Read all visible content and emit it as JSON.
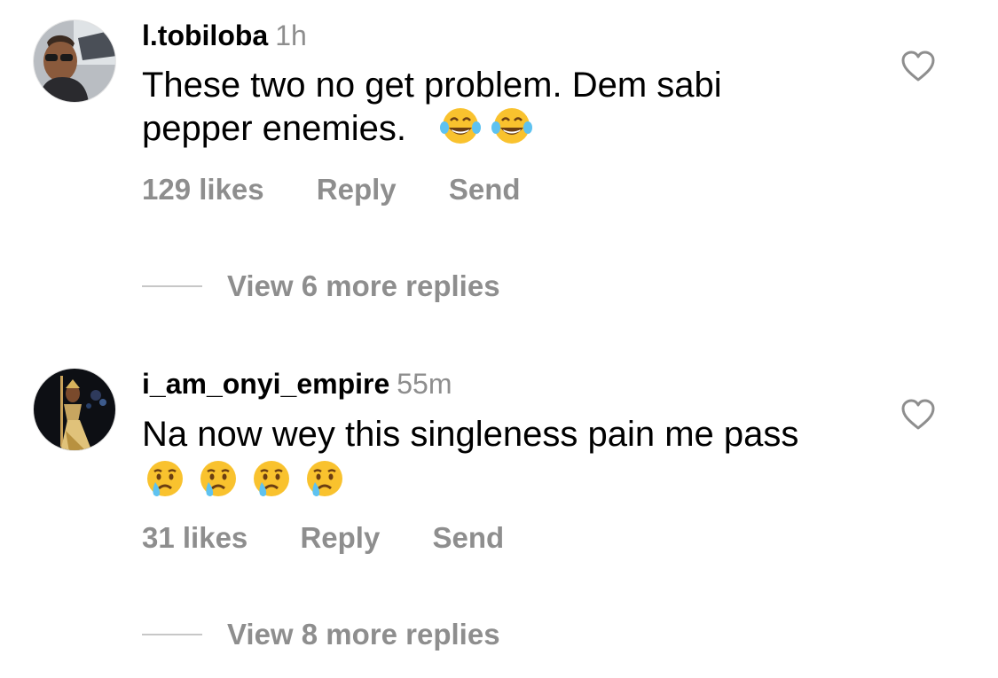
{
  "comments": [
    {
      "username": "l.tobiloba",
      "time": "1h",
      "text_line1": "These two no get problem. Dem sabi",
      "text_line2": "pepper enemies.",
      "emojis": [
        "face-with-tears-of-joy-icon",
        "face-with-tears-of-joy-icon"
      ],
      "likes": "129 likes",
      "reply": "Reply",
      "send": "Send",
      "view_replies": "View 6 more replies"
    },
    {
      "username": "i_am_onyi_empire",
      "time": "55m",
      "text_line1": "Na now wey this singleness pain me pass",
      "emojis": [
        "crying-face-icon",
        "crying-face-icon",
        "crying-face-icon",
        "crying-face-icon"
      ],
      "likes": "31 likes",
      "reply": "Reply",
      "send": "Send",
      "view_replies": "View 8 more replies"
    }
  ],
  "colors": {
    "secondary_text": "#8e8e8e",
    "primary_text": "#000000",
    "divider": "#c7c7c7"
  }
}
